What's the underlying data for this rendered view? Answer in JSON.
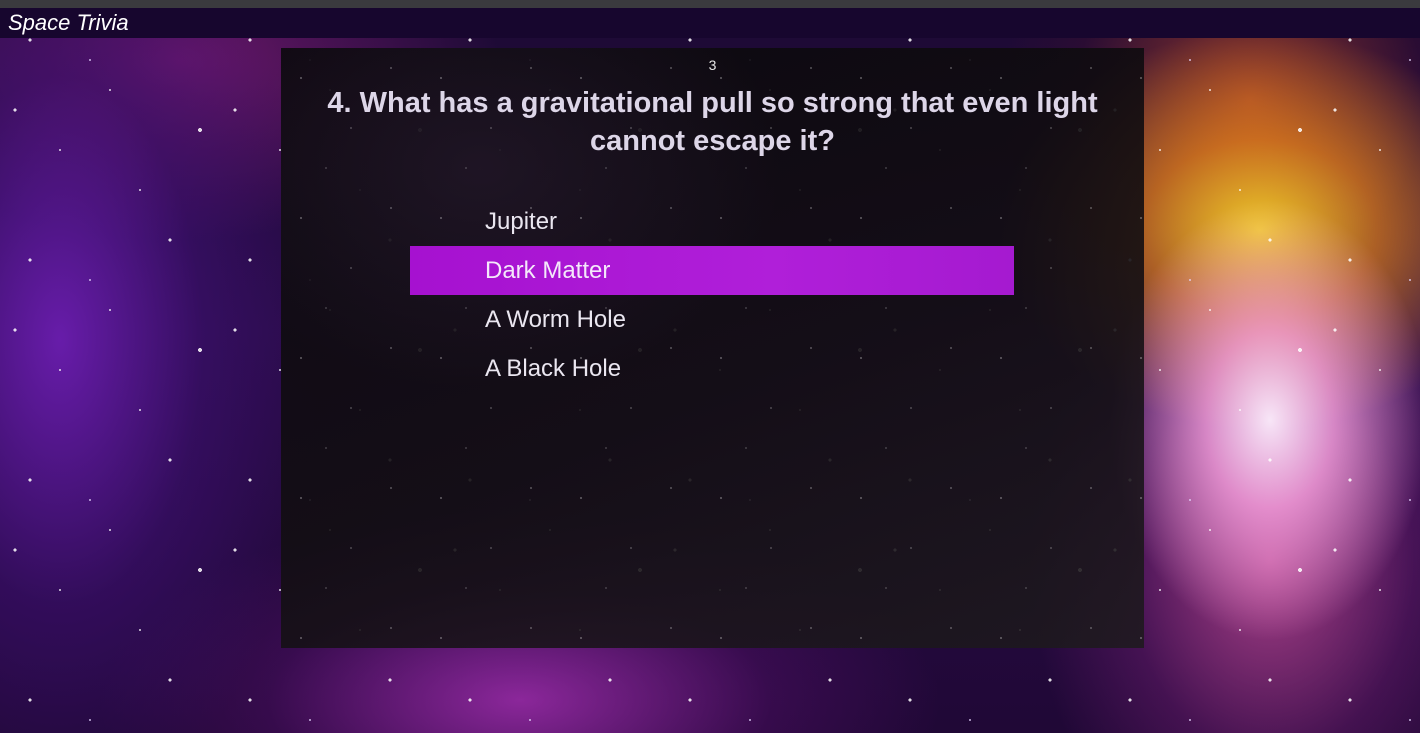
{
  "header": {
    "title": "Space Trivia"
  },
  "quiz": {
    "timer": "3",
    "question": "4. What has a gravitational pull so strong that even light cannot escape it?",
    "answers": [
      {
        "label": "Jupiter",
        "selected": false
      },
      {
        "label": "Dark Matter",
        "selected": true
      },
      {
        "label": "A Worm Hole",
        "selected": false
      },
      {
        "label": "A Black Hole",
        "selected": false
      }
    ],
    "highlight_color": "#a611d0"
  }
}
